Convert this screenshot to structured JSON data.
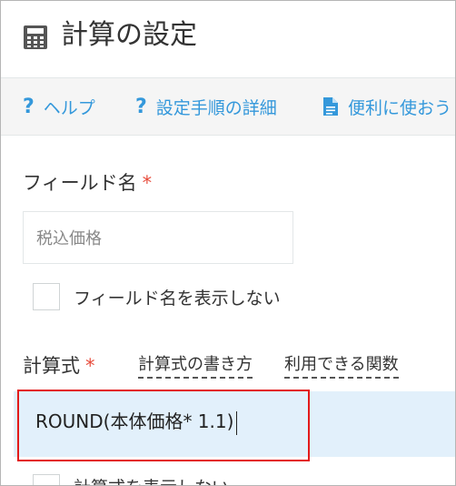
{
  "header": {
    "title": "計算の設定",
    "icon": "calculator-icon"
  },
  "toolbar": {
    "help_label": "ヘルプ",
    "steps_label": "設定手順の詳細",
    "tips_label": "便利に使おう",
    "help_icon": "question-icon",
    "tips_icon": "document-icon"
  },
  "field_name": {
    "label": "フィールド名",
    "required_mark": "*",
    "placeholder": "税込価格",
    "hide_label": "フィールド名を表示しない"
  },
  "formula": {
    "label": "計算式",
    "required_mark": "*",
    "howto_link": "計算式の書き方",
    "functions_link": "利用できる関数",
    "value": "ROUND(本体価格* 1.1)",
    "hide_label": "計算式を表示しない"
  },
  "colors": {
    "accent": "#3498db",
    "required": "#e74c3c",
    "highlight": "#e31a1a",
    "input_bg": "#e2f0fb"
  }
}
